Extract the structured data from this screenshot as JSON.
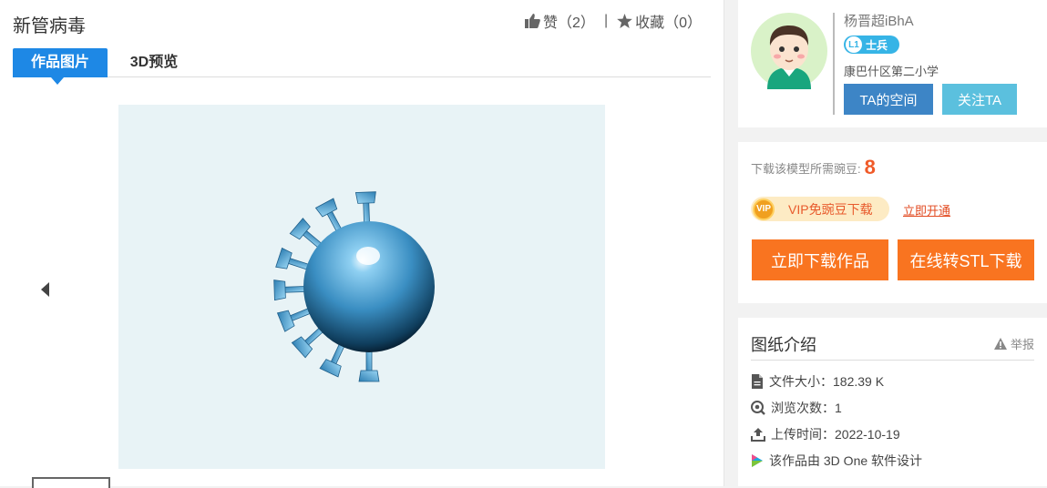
{
  "title": "新管病毒",
  "actions": {
    "like_label": "赞（2）",
    "fav_label": "收藏（0）",
    "separator": "|"
  },
  "tabs": [
    {
      "label": "作品图片"
    },
    {
      "label": "3D预览"
    }
  ],
  "user": {
    "name": "杨晋超iBhA",
    "level": "L1",
    "rank": "士兵",
    "school": "康巴什区第二小学",
    "space_button": "TA的空间",
    "follow_button": "关注TA"
  },
  "download": {
    "cost_label": "下载该模型所需豌豆:",
    "cost_value": "8",
    "vip_icon": "VIP",
    "vip_label": "VIP免豌豆下载",
    "open_link": "立即开通",
    "download_button": "立即下载作品",
    "stl_button": "在线转STL下载"
  },
  "info": {
    "title": "图纸介绍",
    "report": "举报",
    "file_size": "文件大小：182.39 K",
    "views": "浏览次数：1",
    "upload_time": "上传时间：2022-10-19",
    "software": "该作品由 3D One 软件设计"
  },
  "colors": {
    "primary": "#1e88e5",
    "orange": "#f97420",
    "cost": "#f05a28"
  },
  "icons": [
    "thumb-up-icon",
    "star-icon",
    "left-arrow-icon",
    "warning-icon",
    "file-icon",
    "eye-icon",
    "upload-icon",
    "3d-one-icon"
  ]
}
